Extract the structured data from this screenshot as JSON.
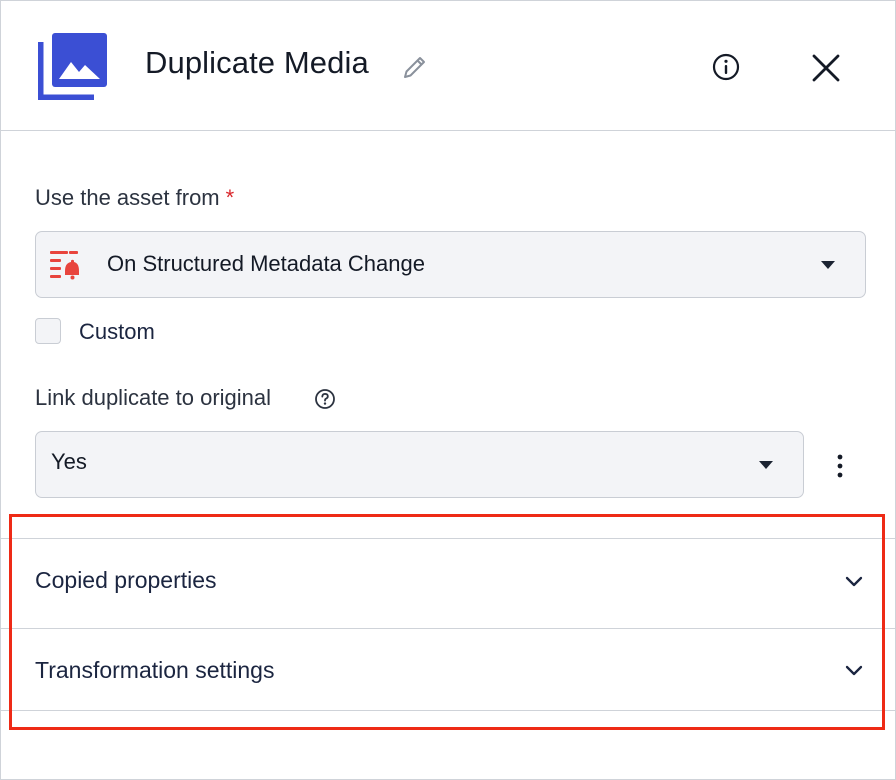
{
  "dialog": {
    "title": "Duplicate Media",
    "app_icon": "media-library-icon",
    "accent_color": "#3b4fd4",
    "header_actions": {
      "edit_icon": "pencil-icon",
      "info_icon": "info-icon",
      "close_icon": "close-icon"
    }
  },
  "asset_source": {
    "label": "Use the asset from",
    "required_mark": "*",
    "selected_value": "On Structured Metadata Change",
    "trigger_icon": "metadata-change-bell-icon",
    "trigger_icon_color": "#e8443d"
  },
  "custom_option": {
    "label": "Custom",
    "checked": false
  },
  "link_duplicate": {
    "label": "Link duplicate to original",
    "help_icon": "help-icon",
    "selected_value": "Yes",
    "more_icon": "kebab-menu-icon"
  },
  "accordion": {
    "sections": [
      {
        "label": "Copied properties",
        "expanded": false
      },
      {
        "label": "Transformation settings",
        "expanded": false
      }
    ],
    "highlight_color": "#ee2a16"
  }
}
